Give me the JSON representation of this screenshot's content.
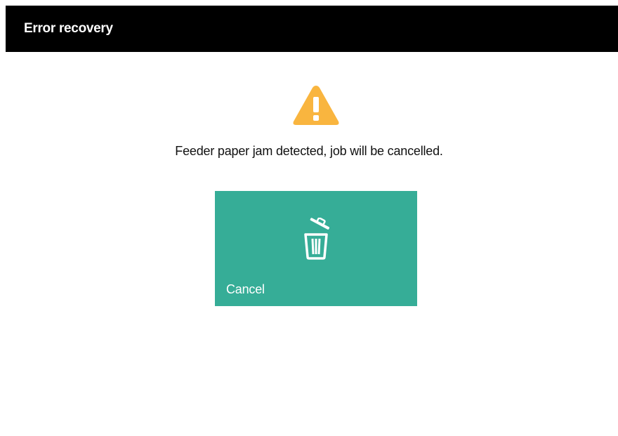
{
  "header": {
    "title": "Error recovery"
  },
  "alert": {
    "icon": "warning-icon",
    "icon_color": "#F9B53F",
    "message": "Feeder paper jam detected, job will be cancelled."
  },
  "actions": {
    "cancel": {
      "label": "Cancel",
      "icon": "trash-icon",
      "color": "#36AD97"
    }
  }
}
